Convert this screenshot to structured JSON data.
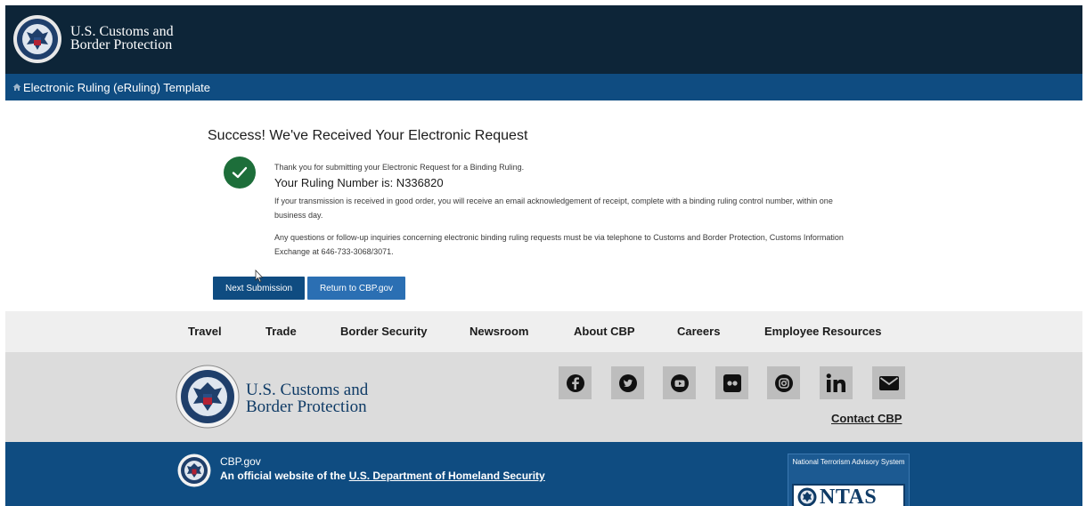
{
  "header": {
    "agency_line1": "U.S. Customs and",
    "agency_line2": "Border Protection",
    "seal_icon": "cbp-seal-icon"
  },
  "breadcrumb": {
    "home_icon": "home-icon",
    "label": "Electronic Ruling (eRuling) Template"
  },
  "main": {
    "title": "Success! We've Received Your Electronic Request",
    "status_icon": "check-circle-icon",
    "thanks": "Thank you for submitting your Electronic Request for a Binding Ruling.",
    "ruling_number": "Your Ruling Number is: N336820",
    "ack": "If your transmission is received in good order, you will receive an email acknowledgement of receipt, complete with a binding ruling control number, within one business day.",
    "questions": "Any questions or follow-up inquiries concerning electronic binding ruling requests must be via telephone to Customs and Border Protection, Customs Information Exchange at 646-733-3068/3071.",
    "next_button": "Next Submission",
    "return_button": "Return to CBP.gov"
  },
  "nav": {
    "items": [
      "Travel",
      "Trade",
      "Border Security",
      "Newsroom",
      "About CBP",
      "Careers",
      "Employee Resources"
    ]
  },
  "footer": {
    "agency_line1": "U.S. Customs and",
    "agency_line2": "Border Protection",
    "social_icons": [
      "facebook-icon",
      "twitter-icon",
      "youtube-icon",
      "flickr-icon",
      "instagram-icon",
      "linkedin-icon",
      "email-icon"
    ],
    "contact": "Contact CBP",
    "site": "CBP.gov",
    "official_prefix": "An official website of the ",
    "official_link": "U.S. Department of Homeland Security",
    "ntas_caption": "National Terrorism Advisory System",
    "ntas_word": "NTAS"
  },
  "colors": {
    "header_bg": "#0d2538",
    "brand_blue": "#0f4c81",
    "success_green": "#1d6e3a"
  }
}
